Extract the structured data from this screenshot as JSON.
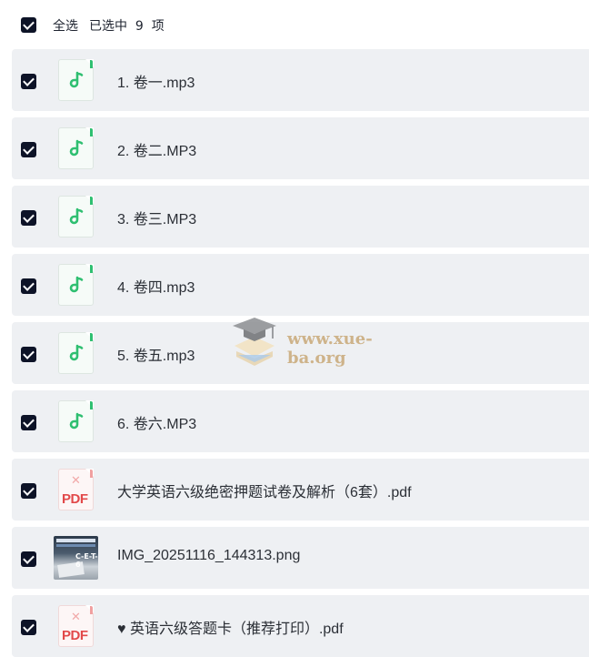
{
  "header": {
    "select_all_label": "全选",
    "selected_text": "已选中  9  项"
  },
  "files": [
    {
      "name": "1. 卷一.mp3",
      "type": "audio"
    },
    {
      "name": "2. 卷二.MP3",
      "type": "audio"
    },
    {
      "name": "3. 卷三.MP3",
      "type": "audio"
    },
    {
      "name": "4. 卷四.mp3",
      "type": "audio"
    },
    {
      "name": "5. 卷五.mp3",
      "type": "audio"
    },
    {
      "name": "6. 卷六.MP3",
      "type": "audio"
    },
    {
      "name": "大学英语六级绝密押题试卷及解析（6套）.pdf",
      "type": "pdf"
    },
    {
      "name": "IMG_20251116_144313.png",
      "type": "image"
    },
    {
      "name": "♥ 英语六级答题卡（推荐打印）.pdf",
      "type": "pdf"
    }
  ],
  "icons": {
    "audio": "music-note-icon",
    "pdf": "pdf-file-icon",
    "pdf_label": "PDF",
    "image": "image-thumbnail"
  },
  "thumbnail_text": "C-E-T-6",
  "watermark": {
    "text": "www.xue-ba.org"
  },
  "colors": {
    "checkbox": "#0d1327",
    "row_bg": "#eef0f3",
    "audio_accent": "#2fbf71",
    "pdf_accent": "#e2494a",
    "watermark": "#c9a978"
  }
}
